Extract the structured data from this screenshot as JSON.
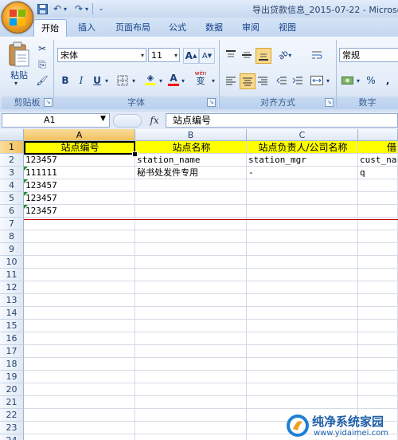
{
  "window": {
    "title": "导出贷款信息_2015-07-22 - Microso"
  },
  "quick_access": {
    "save_icon": "save-icon",
    "undo_icon": "undo-icon",
    "redo_icon": "redo-icon"
  },
  "tabs": [
    {
      "label": "开始",
      "active": true
    },
    {
      "label": "插入"
    },
    {
      "label": "页面布局"
    },
    {
      "label": "公式"
    },
    {
      "label": "数据"
    },
    {
      "label": "审阅"
    },
    {
      "label": "视图"
    }
  ],
  "ribbon": {
    "clipboard": {
      "paste_label": "粘贴",
      "group_label": "剪贴板"
    },
    "font": {
      "font_name": "宋体",
      "font_size": "11",
      "grow": "A",
      "shrink": "A",
      "bold": "B",
      "italic": "I",
      "underline": "U",
      "font_color_letter": "A",
      "wen": "wén",
      "wen_char": "变",
      "group_label": "字体"
    },
    "alignment": {
      "group_label": "对齐方式"
    },
    "number": {
      "format": "常规",
      "percent": "%",
      "comma": ",",
      "group_label": "数字"
    },
    "colors": {
      "highlight": "#ffff00",
      "font_color": "#ff0000"
    }
  },
  "formula_bar": {
    "name_box": "A1",
    "fx": "fx",
    "content": "站点编号"
  },
  "sheet": {
    "columns": [
      "A",
      "B",
      "C",
      "借"
    ],
    "selected_cell": "A1",
    "rows": [
      {
        "n": "1",
        "cells": [
          "站点编号",
          "站点名称",
          "站点负责人/公司名称",
          "借"
        ]
      },
      {
        "n": "2",
        "cells": [
          "123457",
          "station_name",
          "station_mgr",
          "cust_na"
        ]
      },
      {
        "n": "3",
        "cells": [
          "111111",
          "秘书处发件专用",
          "-",
          "q"
        ]
      },
      {
        "n": "4",
        "cells": [
          "123457",
          "",
          "",
          ""
        ]
      },
      {
        "n": "5",
        "cells": [
          "123457",
          "",
          "",
          ""
        ]
      },
      {
        "n": "6",
        "cells": [
          "123457",
          "",
          "",
          ""
        ]
      },
      {
        "n": "7"
      },
      {
        "n": "8"
      },
      {
        "n": "9"
      },
      {
        "n": "10"
      },
      {
        "n": "11"
      },
      {
        "n": "12"
      },
      {
        "n": "13"
      },
      {
        "n": "14"
      },
      {
        "n": "15"
      },
      {
        "n": "16"
      },
      {
        "n": "17"
      },
      {
        "n": "18"
      },
      {
        "n": "19"
      },
      {
        "n": "20"
      },
      {
        "n": "21"
      },
      {
        "n": "22"
      },
      {
        "n": "23"
      },
      {
        "n": "24"
      }
    ],
    "header_fill": "#ffff00",
    "divider_color": "#c00000"
  },
  "watermark": {
    "title": "纯净系统家园",
    "url": "www.yidaimei.com"
  }
}
